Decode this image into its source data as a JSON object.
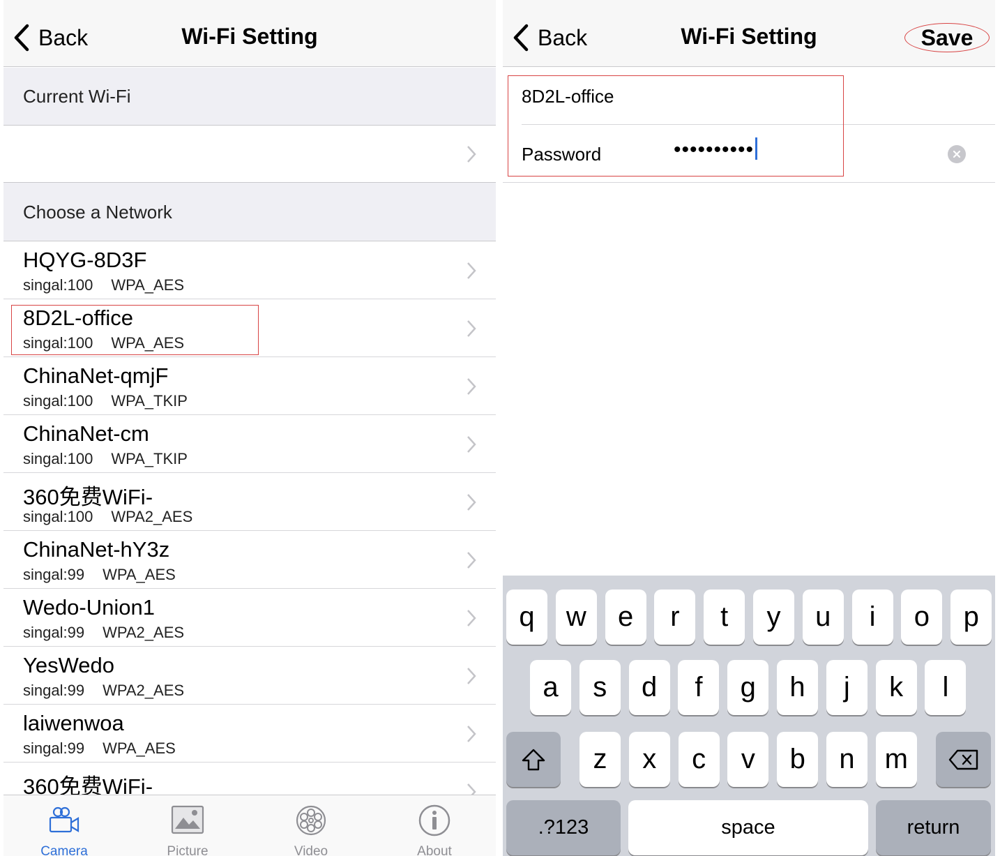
{
  "left": {
    "back_label": "Back",
    "title": "Wi-Fi Setting",
    "current_header": "Current Wi-Fi",
    "choose_header": "Choose a Network",
    "networks": [
      {
        "name": "HQYG-8D3F",
        "signal": "singal:100",
        "security": "WPA_AES"
      },
      {
        "name": "8D2L-office",
        "signal": "singal:100",
        "security": "WPA_AES"
      },
      {
        "name": "ChinaNet-qmjF",
        "signal": "singal:100",
        "security": "WPA_TKIP"
      },
      {
        "name": "ChinaNet-cm",
        "signal": "singal:100",
        "security": "WPA_TKIP"
      },
      {
        "name": "360免费WiFi-",
        "signal": "singal:100",
        "security": "WPA2_AES"
      },
      {
        "name": "ChinaNet-hY3z",
        "signal": "singal:99",
        "security": "WPA_AES"
      },
      {
        "name": "Wedo-Union1",
        "signal": "singal:99",
        "security": "WPA2_AES"
      },
      {
        "name": "YesWedo",
        "signal": "singal:99",
        "security": "WPA2_AES"
      },
      {
        "name": "laiwenwoa",
        "signal": "singal:99",
        "security": "WPA_AES"
      },
      {
        "name": "360免费WiFi-",
        "signal": "",
        "security": ""
      }
    ],
    "tabs": [
      {
        "label": "Camera",
        "icon": "camera-icon",
        "active": true
      },
      {
        "label": "Picture",
        "icon": "picture-icon",
        "active": false
      },
      {
        "label": "Video",
        "icon": "film-reel-icon",
        "active": false
      },
      {
        "label": "About",
        "icon": "info-icon",
        "active": false
      }
    ]
  },
  "right": {
    "back_label": "Back",
    "title": "Wi-Fi Setting",
    "save_label": "Save",
    "ssid": "8D2L-office",
    "password_label": "Password",
    "password_value": "••••••••••",
    "keyboard": {
      "row1": [
        "q",
        "w",
        "e",
        "r",
        "t",
        "y",
        "u",
        "i",
        "o",
        "p"
      ],
      "row2": [
        "a",
        "s",
        "d",
        "f",
        "g",
        "h",
        "j",
        "k",
        "l"
      ],
      "row3": [
        "z",
        "x",
        "c",
        "v",
        "b",
        "n",
        "m"
      ],
      "numbers_label": ".?123",
      "space_label": "space",
      "return_label": "return"
    }
  },
  "colors": {
    "highlight": "#d84444",
    "accent": "#2e6fd8",
    "section_bg": "#efeff4",
    "keyboard_bg": "#d1d4db"
  }
}
